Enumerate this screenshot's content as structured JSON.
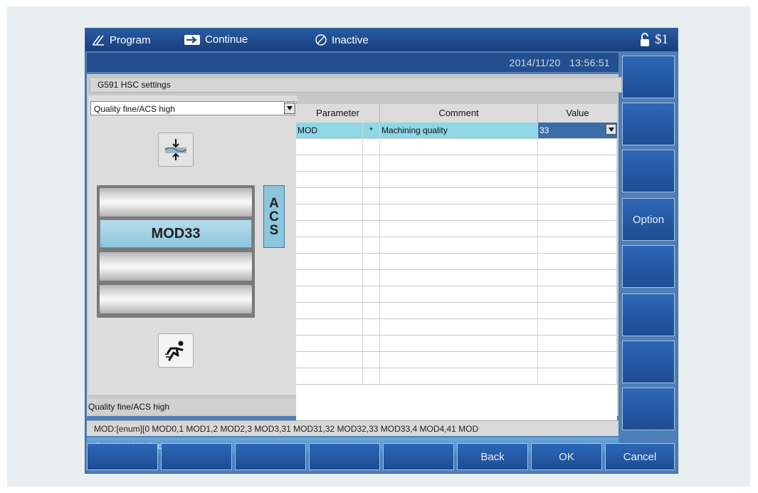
{
  "titlebar": {
    "mode_label": "Program",
    "continue_label": "Continue",
    "status_label": "Inactive",
    "channel_label": "$1"
  },
  "datetime": "2014/11/20   13:56:51",
  "form": {
    "title": "G591 HSC settings",
    "mode_select_value": "Quality fine/ACS high",
    "status_text": "Quality fine/ACS high",
    "active_layer_label": "MOD33",
    "acs_letters": [
      "A",
      "C",
      "S"
    ]
  },
  "table": {
    "headers": [
      "Parameter",
      "Comment",
      "Value"
    ],
    "rows": [
      {
        "parameter": "MOD",
        "marker": "*",
        "comment": "Machining quality",
        "value": "33"
      }
    ]
  },
  "hint": "MOD:[enum][0 MOD0,1 MOD1,2 MOD2,3 MOD3,31  MOD31,32  MOD32,33  MOD33,4 MOD4,41  MOD",
  "cycle": {
    "title": "Standard NC Cycle",
    "page": "1/1"
  },
  "softkeys": {
    "vertical": [
      "",
      "",
      "",
      "Option",
      "",
      "",
      "",
      ""
    ],
    "horizontal": [
      "",
      "",
      "",
      "",
      "",
      "Back",
      "OK",
      "Cancel"
    ]
  },
  "colors": {
    "titlebar": "#1f4a8c",
    "highlight_row": "#8fd6e6",
    "softkey": "#2558a3",
    "cycle_bar": "#5a9ad2"
  }
}
